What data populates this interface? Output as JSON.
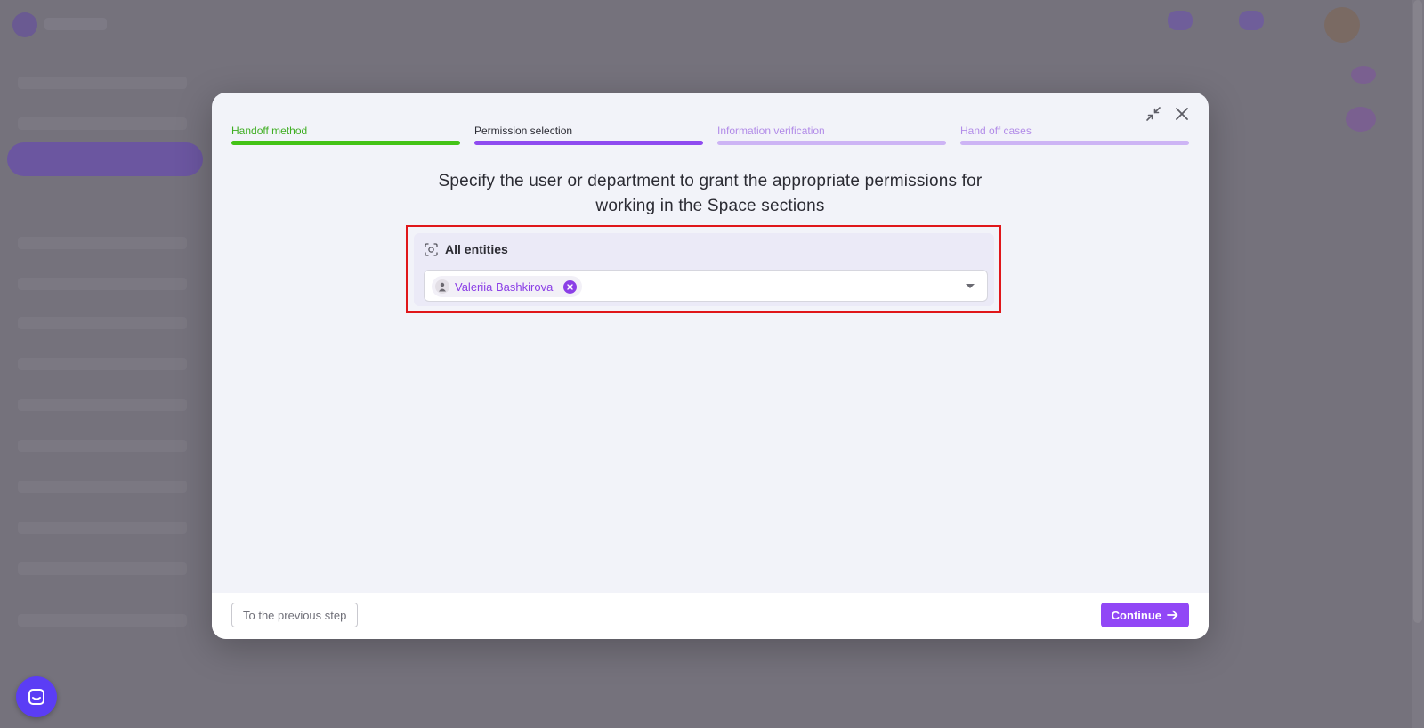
{
  "steps": [
    {
      "label": "Handoff method",
      "state": "done"
    },
    {
      "label": "Permission selection",
      "state": "current"
    },
    {
      "label": "Information verification",
      "state": "future"
    },
    {
      "label": "Hand off cases",
      "state": "future"
    }
  ],
  "modal": {
    "title_line1": "Specify the user or department to grant the appropriate permissions for",
    "title_line2": "working in the Space sections"
  },
  "entities": {
    "header": "All entities",
    "selected_user": "Valeriia Bashkirova"
  },
  "footer": {
    "prev_label": "To the previous step",
    "continue_label": "Continue"
  },
  "colors": {
    "accent": "#9147f6",
    "done": "#44c317",
    "highlight": "#e0161a"
  },
  "icons": {
    "minimize": "collapse-arrows-icon",
    "close": "close-icon",
    "entities": "scan-icon",
    "chevron": "chevron-down-icon",
    "continue": "arrow-right-icon",
    "chat": "chat-icon"
  }
}
